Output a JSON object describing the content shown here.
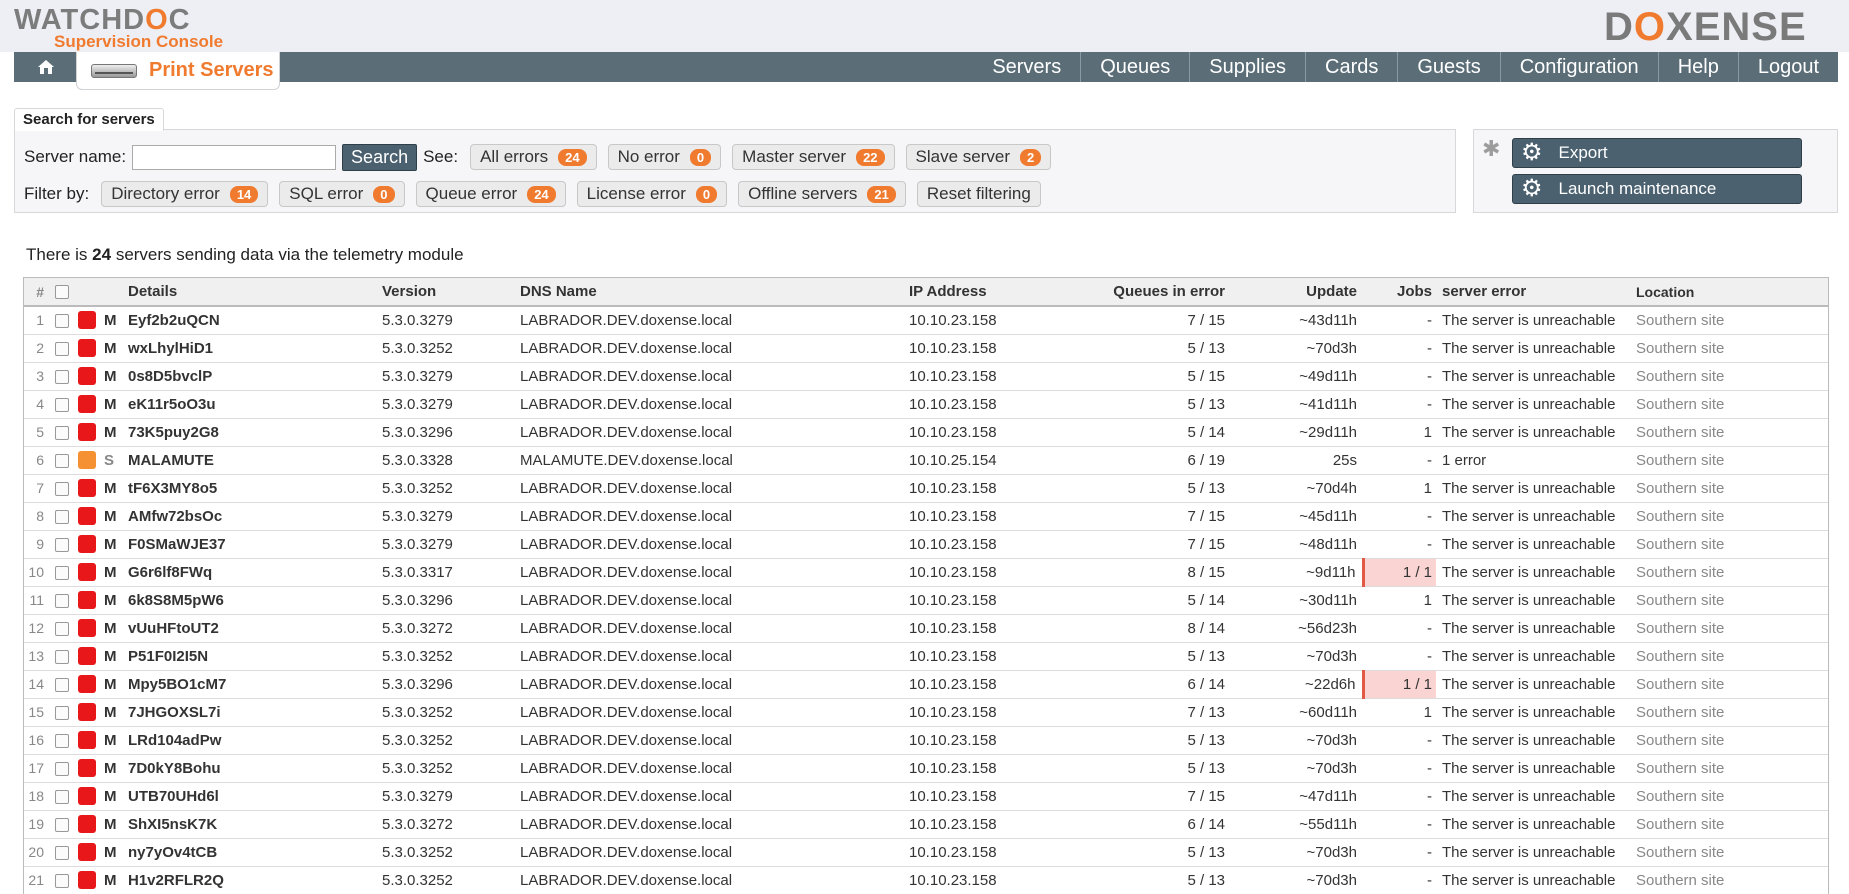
{
  "header": {
    "logo_left_main_a": "WATCHD",
    "logo_left_main_x": "O",
    "logo_left_main_b": "C",
    "logo_left_sub": "Supervision Console",
    "logo_right_a": "D",
    "logo_right_x": "O",
    "logo_right_b": "XENSE",
    "home_icon": "home-icon",
    "active_tab": "Print Servers",
    "nav": [
      "Servers",
      "Queues",
      "Supplies",
      "Cards",
      "Guests",
      "Configuration",
      "Help",
      "Logout"
    ]
  },
  "search": {
    "legend": "Search for servers",
    "server_name_label": "Server name:",
    "server_name_value": "",
    "search_button": "Search",
    "see_label": "See:",
    "see_filters": [
      {
        "label": "All errors",
        "count": "24"
      },
      {
        "label": "No error",
        "count": "0"
      },
      {
        "label": "Master server",
        "count": "22"
      },
      {
        "label": "Slave server",
        "count": "2"
      }
    ],
    "filter_by_label": "Filter by:",
    "filters": [
      {
        "label": "Directory error",
        "count": "14"
      },
      {
        "label": "SQL error",
        "count": "0"
      },
      {
        "label": "Queue error",
        "count": "24"
      },
      {
        "label": "License error",
        "count": "0"
      },
      {
        "label": "Offline servers",
        "count": "21"
      }
    ],
    "reset_label": "Reset filtering"
  },
  "actions": {
    "export_label": "Export",
    "maintenance_label": "Launch maintenance"
  },
  "telemetry": {
    "prefix": "There is",
    "count": "24",
    "suffix": "servers sending data via the telemetry module"
  },
  "table": {
    "headers": {
      "num": "#",
      "details": "Details",
      "version": "Version",
      "dns": "DNS Name",
      "ip": "IP Address",
      "queues": "Queues in error",
      "update": "Update",
      "jobs": "Jobs",
      "error": "server error",
      "location": "Location"
    },
    "rows": [
      {
        "n": "1",
        "status": "red",
        "role": "M",
        "name": "Eyf2b2uQCN",
        "version": "5.3.0.3279",
        "dns": "LABRADOR.DEV.doxense.local",
        "ip": "10.10.23.158",
        "queues": "7 / 15",
        "update": "~43d11h",
        "jobs": "-",
        "jobs_hot": false,
        "error": "The server is unreachable",
        "location": "Southern site"
      },
      {
        "n": "2",
        "status": "red",
        "role": "M",
        "name": "wxLhylHiD1",
        "version": "5.3.0.3252",
        "dns": "LABRADOR.DEV.doxense.local",
        "ip": "10.10.23.158",
        "queues": "5 / 13",
        "update": "~70d3h",
        "jobs": "-",
        "jobs_hot": false,
        "error": "The server is unreachable",
        "location": "Southern site"
      },
      {
        "n": "3",
        "status": "red",
        "role": "M",
        "name": "0s8D5bvclP",
        "version": "5.3.0.3279",
        "dns": "LABRADOR.DEV.doxense.local",
        "ip": "10.10.23.158",
        "queues": "5 / 15",
        "update": "~49d11h",
        "jobs": "-",
        "jobs_hot": false,
        "error": "The server is unreachable",
        "location": "Southern site"
      },
      {
        "n": "4",
        "status": "red",
        "role": "M",
        "name": "eK11r5oO3u",
        "version": "5.3.0.3279",
        "dns": "LABRADOR.DEV.doxense.local",
        "ip": "10.10.23.158",
        "queues": "5 / 13",
        "update": "~41d11h",
        "jobs": "-",
        "jobs_hot": false,
        "error": "The server is unreachable",
        "location": "Southern site"
      },
      {
        "n": "5",
        "status": "red",
        "role": "M",
        "name": "73K5puy2G8",
        "version": "5.3.0.3296",
        "dns": "LABRADOR.DEV.doxense.local",
        "ip": "10.10.23.158",
        "queues": "5 / 14",
        "update": "~29d11h",
        "jobs": "1",
        "jobs_hot": false,
        "error": "The server is unreachable",
        "location": "Southern site"
      },
      {
        "n": "6",
        "status": "orange",
        "role": "S",
        "name": "MALAMUTE",
        "version": "5.3.0.3328",
        "dns": "MALAMUTE.DEV.doxense.local",
        "ip": "10.10.25.154",
        "queues": "6 / 19",
        "update": "25s",
        "jobs": "-",
        "jobs_hot": false,
        "error": "1 error",
        "location": "Southern site"
      },
      {
        "n": "7",
        "status": "red",
        "role": "M",
        "name": "tF6X3MY8o5",
        "version": "5.3.0.3252",
        "dns": "LABRADOR.DEV.doxense.local",
        "ip": "10.10.23.158",
        "queues": "5 / 13",
        "update": "~70d4h",
        "jobs": "1",
        "jobs_hot": false,
        "error": "The server is unreachable",
        "location": "Southern site"
      },
      {
        "n": "8",
        "status": "red",
        "role": "M",
        "name": "AMfw72bsOc",
        "version": "5.3.0.3279",
        "dns": "LABRADOR.DEV.doxense.local",
        "ip": "10.10.23.158",
        "queues": "7 / 15",
        "update": "~45d11h",
        "jobs": "-",
        "jobs_hot": false,
        "error": "The server is unreachable",
        "location": "Southern site"
      },
      {
        "n": "9",
        "status": "red",
        "role": "M",
        "name": "F0SMaWJE37",
        "version": "5.3.0.3279",
        "dns": "LABRADOR.DEV.doxense.local",
        "ip": "10.10.23.158",
        "queues": "7 / 15",
        "update": "~48d11h",
        "jobs": "-",
        "jobs_hot": false,
        "error": "The server is unreachable",
        "location": "Southern site"
      },
      {
        "n": "10",
        "status": "red",
        "role": "M",
        "name": "G6r6lf8FWq",
        "version": "5.3.0.3317",
        "dns": "LABRADOR.DEV.doxense.local",
        "ip": "10.10.23.158",
        "queues": "8 / 15",
        "update": "~9d11h",
        "jobs": "1 / 1",
        "jobs_hot": true,
        "error": "The server is unreachable",
        "location": "Southern site"
      },
      {
        "n": "11",
        "status": "red",
        "role": "M",
        "name": "6k8S8M5pW6",
        "version": "5.3.0.3296",
        "dns": "LABRADOR.DEV.doxense.local",
        "ip": "10.10.23.158",
        "queues": "5 / 14",
        "update": "~30d11h",
        "jobs": "1",
        "jobs_hot": false,
        "error": "The server is unreachable",
        "location": "Southern site"
      },
      {
        "n": "12",
        "status": "red",
        "role": "M",
        "name": "vUuHFtoUT2",
        "version": "5.3.0.3272",
        "dns": "LABRADOR.DEV.doxense.local",
        "ip": "10.10.23.158",
        "queues": "8 / 14",
        "update": "~56d23h",
        "jobs": "-",
        "jobs_hot": false,
        "error": "The server is unreachable",
        "location": "Southern site"
      },
      {
        "n": "13",
        "status": "red",
        "role": "M",
        "name": "P51F0I2I5N",
        "version": "5.3.0.3252",
        "dns": "LABRADOR.DEV.doxense.local",
        "ip": "10.10.23.158",
        "queues": "5 / 13",
        "update": "~70d3h",
        "jobs": "-",
        "jobs_hot": false,
        "error": "The server is unreachable",
        "location": "Southern site"
      },
      {
        "n": "14",
        "status": "red",
        "role": "M",
        "name": "Mpy5BO1cM7",
        "version": "5.3.0.3296",
        "dns": "LABRADOR.DEV.doxense.local",
        "ip": "10.10.23.158",
        "queues": "6 / 14",
        "update": "~22d6h",
        "jobs": "1 / 1",
        "jobs_hot": true,
        "error": "The server is unreachable",
        "location": "Southern site"
      },
      {
        "n": "15",
        "status": "red",
        "role": "M",
        "name": "7JHGOXSL7i",
        "version": "5.3.0.3252",
        "dns": "LABRADOR.DEV.doxense.local",
        "ip": "10.10.23.158",
        "queues": "7 / 13",
        "update": "~60d11h",
        "jobs": "1",
        "jobs_hot": false,
        "error": "The server is unreachable",
        "location": "Southern site"
      },
      {
        "n": "16",
        "status": "red",
        "role": "M",
        "name": "LRd104adPw",
        "version": "5.3.0.3252",
        "dns": "LABRADOR.DEV.doxense.local",
        "ip": "10.10.23.158",
        "queues": "5 / 13",
        "update": "~70d3h",
        "jobs": "-",
        "jobs_hot": false,
        "error": "The server is unreachable",
        "location": "Southern site"
      },
      {
        "n": "17",
        "status": "red",
        "role": "M",
        "name": "7D0kY8Bohu",
        "version": "5.3.0.3252",
        "dns": "LABRADOR.DEV.doxense.local",
        "ip": "10.10.23.158",
        "queues": "5 / 13",
        "update": "~70d3h",
        "jobs": "-",
        "jobs_hot": false,
        "error": "The server is unreachable",
        "location": "Southern site"
      },
      {
        "n": "18",
        "status": "red",
        "role": "M",
        "name": "UTB70UHd6l",
        "version": "5.3.0.3279",
        "dns": "LABRADOR.DEV.doxense.local",
        "ip": "10.10.23.158",
        "queues": "7 / 15",
        "update": "~47d11h",
        "jobs": "-",
        "jobs_hot": false,
        "error": "The server is unreachable",
        "location": "Southern site"
      },
      {
        "n": "19",
        "status": "red",
        "role": "M",
        "name": "ShXI5nsK7K",
        "version": "5.3.0.3272",
        "dns": "LABRADOR.DEV.doxense.local",
        "ip": "10.10.23.158",
        "queues": "6 / 14",
        "update": "~55d11h",
        "jobs": "-",
        "jobs_hot": false,
        "error": "The server is unreachable",
        "location": "Southern site"
      },
      {
        "n": "20",
        "status": "red",
        "role": "M",
        "name": "ny7yOv4tCB",
        "version": "5.3.0.3252",
        "dns": "LABRADOR.DEV.doxense.local",
        "ip": "10.10.23.158",
        "queues": "5 / 13",
        "update": "~70d3h",
        "jobs": "-",
        "jobs_hot": false,
        "error": "The server is unreachable",
        "location": "Southern site"
      },
      {
        "n": "21",
        "status": "red",
        "role": "M",
        "name": "H1v2RFLR2Q",
        "version": "5.3.0.3252",
        "dns": "LABRADOR.DEV.doxense.local",
        "ip": "10.10.23.158",
        "queues": "5 / 13",
        "update": "~70d3h",
        "jobs": "-",
        "jobs_hot": false,
        "error": "The server is unreachable",
        "location": "Southern site"
      }
    ]
  },
  "colors": {
    "accent": "#f07a2e",
    "navbar": "#5b6e78",
    "status_red": "#e8181a",
    "status_orange": "#f59033"
  }
}
